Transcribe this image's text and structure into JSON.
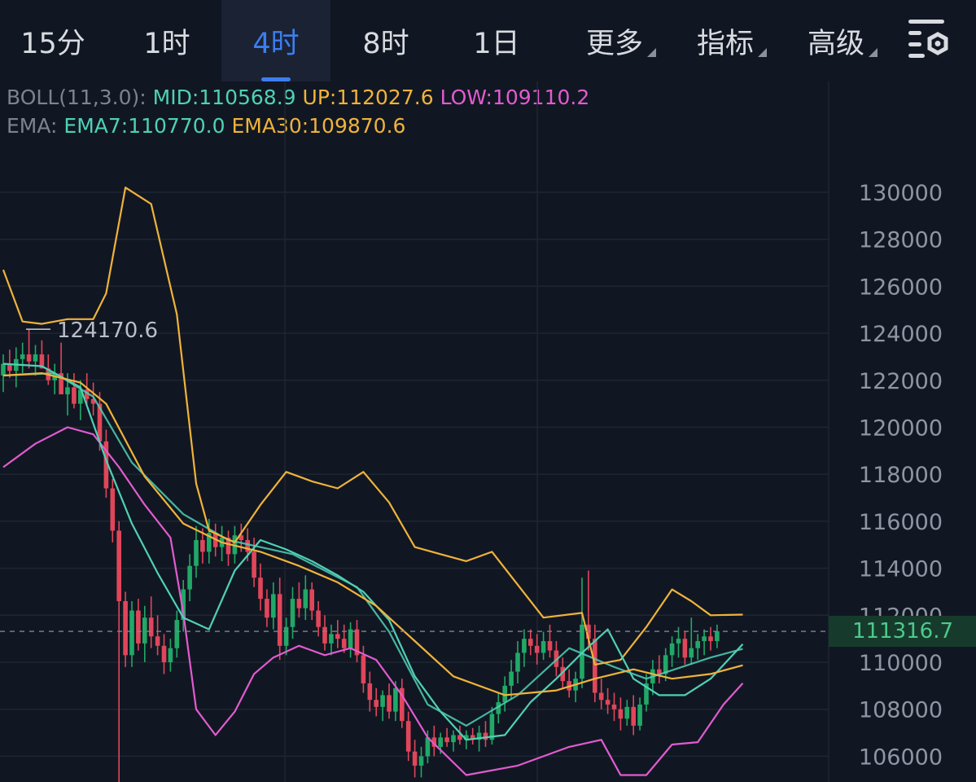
{
  "toolbar": {
    "tabs": [
      {
        "label": "15分",
        "active": false
      },
      {
        "label": "1时",
        "active": false
      },
      {
        "label": "4时",
        "active": true
      },
      {
        "label": "8时",
        "active": false
      },
      {
        "label": "1日",
        "active": false
      }
    ],
    "dropdowns": [
      {
        "label": "更多"
      },
      {
        "label": "指标"
      },
      {
        "label": "高级"
      }
    ],
    "settings_icon": "chart-settings-gear-icon"
  },
  "indicators": {
    "boll": {
      "label": "BOLL(11,3.0):",
      "mid": "MID:110568.9",
      "up": "UP:112027.6",
      "low": "LOW:109110.2"
    },
    "ema": {
      "label": "EMA:",
      "ema7": "EMA7:110770.0",
      "ema30": "EMA30:109870.6"
    }
  },
  "colors": {
    "background": "#111722",
    "up_candle": "#21a867",
    "down_candle": "#e0465a",
    "boll_mid": "#4fd1b6",
    "boll_up": "#f0b33a",
    "boll_low": "#e15bd0",
    "ema7": "#4fd1b6",
    "ema30": "#f0b33a",
    "active_tab": "#3c7ef0"
  },
  "chart_data": {
    "type": "candlestick",
    "ylim": [
      105000,
      132000
    ],
    "y_ticks": [
      "130000",
      "128000",
      "126000",
      "124000",
      "122000",
      "120000",
      "118000",
      "116000",
      "114000",
      "112000",
      "110000",
      "108000",
      "106000"
    ],
    "high_marker": "124170.6",
    "current_price": "111316.7",
    "candles": [
      [
        122200,
        123100,
        121500,
        122700
      ],
      [
        122700,
        123300,
        122100,
        122400
      ],
      [
        122400,
        123400,
        121700,
        122900
      ],
      [
        122900,
        123600,
        122300,
        123100
      ],
      [
        123100,
        124170.6,
        122500,
        122800
      ],
      [
        122800,
        123500,
        122200,
        123100
      ],
      [
        123100,
        123700,
        122600,
        122500
      ],
      [
        122500,
        123100,
        121800,
        122000
      ],
      [
        122000,
        122700,
        121400,
        122300
      ],
      [
        122300,
        123600,
        121900,
        121400
      ],
      [
        121400,
        122300,
        120500,
        121700
      ],
      [
        121700,
        122300,
        120800,
        121000
      ],
      [
        121000,
        122000,
        120300,
        121600
      ],
      [
        121600,
        122300,
        120900,
        121200
      ],
      [
        121200,
        121900,
        120500,
        121000
      ],
      [
        121000,
        121500,
        119000,
        119400
      ],
      [
        119400,
        119900,
        117000,
        117400
      ],
      [
        117400,
        117800,
        115100,
        115600
      ],
      [
        115600,
        116000,
        104000,
        112600
      ],
      [
        112600,
        113000,
        109800,
        110300
      ],
      [
        110300,
        112600,
        109800,
        112200
      ],
      [
        112200,
        112700,
        110500,
        110800
      ],
      [
        110800,
        112400,
        110000,
        111900
      ],
      [
        111900,
        112800,
        110600,
        111100
      ],
      [
        111100,
        112000,
        110300,
        110700
      ],
      [
        110700,
        111200,
        109500,
        110000
      ],
      [
        110000,
        111000,
        109600,
        110600
      ],
      [
        110600,
        112200,
        110200,
        111800
      ],
      [
        111800,
        113500,
        111300,
        113100
      ],
      [
        113100,
        114600,
        112600,
        114100
      ],
      [
        114100,
        115800,
        113600,
        115200
      ],
      [
        115200,
        115700,
        114200,
        114700
      ],
      [
        114700,
        116100,
        114200,
        115500
      ],
      [
        115500,
        115900,
        114500,
        114900
      ],
      [
        114900,
        115800,
        114300,
        115300
      ],
      [
        115300,
        115600,
        114100,
        114600
      ],
      [
        114600,
        115800,
        114200,
        115400
      ],
      [
        115400,
        115900,
        114700,
        115200
      ],
      [
        115200,
        115700,
        114300,
        114700
      ],
      [
        114700,
        115300,
        113200,
        113600
      ],
      [
        113600,
        114200,
        112200,
        112700
      ],
      [
        112700,
        113100,
        111500,
        111900
      ],
      [
        111900,
        113400,
        111400,
        112900
      ],
      [
        112900,
        113600,
        110100,
        110700
      ],
      [
        110700,
        111900,
        110300,
        111500
      ],
      [
        111500,
        113200,
        111000,
        112700
      ],
      [
        112700,
        113400,
        111900,
        112300
      ],
      [
        112300,
        113700,
        111800,
        113100
      ],
      [
        113100,
        113400,
        111800,
        112200
      ],
      [
        112200,
        112600,
        111100,
        111500
      ],
      [
        111500,
        112000,
        110500,
        110800
      ],
      [
        110800,
        111600,
        110300,
        111200
      ],
      [
        111200,
        111800,
        110600,
        111000
      ],
      [
        111000,
        111600,
        110400,
        110600
      ],
      [
        110600,
        111700,
        110200,
        111400
      ],
      [
        111400,
        111800,
        110000,
        110300
      ],
      [
        110300,
        110700,
        108700,
        109100
      ],
      [
        109100,
        109600,
        107900,
        108400
      ],
      [
        108400,
        108900,
        107700,
        108100
      ],
      [
        108100,
        108800,
        107500,
        108600
      ],
      [
        108600,
        109100,
        107600,
        107900
      ],
      [
        107900,
        109200,
        107500,
        108900
      ],
      [
        108900,
        109300,
        107200,
        107500
      ],
      [
        107500,
        107900,
        105800,
        106200
      ],
      [
        106200,
        106700,
        105100,
        105600
      ],
      [
        105600,
        106400,
        105100,
        106000
      ],
      [
        106000,
        107100,
        105700,
        106800
      ],
      [
        106800,
        107300,
        106000,
        106400
      ],
      [
        106400,
        107000,
        106100,
        106800
      ],
      [
        106800,
        107200,
        106400,
        106600
      ],
      [
        106600,
        107100,
        106200,
        106900
      ],
      [
        106900,
        107300,
        106500,
        106700
      ],
      [
        106700,
        107100,
        106300,
        106900
      ],
      [
        106900,
        107200,
        106500,
        106700
      ],
      [
        106700,
        107300,
        106200,
        107000
      ],
      [
        107000,
        107500,
        106400,
        106700
      ],
      [
        106700,
        108100,
        106500,
        107800
      ],
      [
        107800,
        108700,
        107400,
        108300
      ],
      [
        108300,
        109400,
        107900,
        109000
      ],
      [
        109000,
        110100,
        108400,
        109600
      ],
      [
        109600,
        110900,
        109100,
        110400
      ],
      [
        110400,
        111400,
        109800,
        111000
      ],
      [
        111000,
        111400,
        110300,
        110700
      ],
      [
        110700,
        111200,
        109900,
        110400
      ],
      [
        110400,
        111300,
        110100,
        110900
      ],
      [
        110900,
        111600,
        110200,
        110500
      ],
      [
        110500,
        110900,
        109400,
        109800
      ],
      [
        109800,
        110200,
        108900,
        109200
      ],
      [
        109200,
        109700,
        108500,
        108800
      ],
      [
        108800,
        109600,
        108300,
        109300
      ],
      [
        109300,
        113600,
        108900,
        111600
      ],
      [
        111600,
        113900,
        110500,
        111000
      ],
      [
        111000,
        111600,
        108300,
        108700
      ],
      [
        108700,
        109300,
        108000,
        108400
      ],
      [
        108400,
        108900,
        107800,
        108200
      ],
      [
        108200,
        108700,
        107500,
        108000
      ],
      [
        108000,
        108500,
        107100,
        107600
      ],
      [
        107600,
        108400,
        107300,
        108100
      ],
      [
        108100,
        108600,
        106900,
        107300
      ],
      [
        107300,
        108500,
        107100,
        108200
      ],
      [
        108200,
        109500,
        107900,
        109100
      ],
      [
        109100,
        110100,
        108600,
        109700
      ],
      [
        109700,
        110300,
        109100,
        109500
      ],
      [
        109500,
        110600,
        109200,
        110300
      ],
      [
        110300,
        111100,
        109800,
        110800
      ],
      [
        110800,
        111500,
        110200,
        111000
      ],
      [
        111000,
        111300,
        109900,
        110200
      ],
      [
        110200,
        111900,
        109900,
        110600
      ],
      [
        110600,
        111200,
        110100,
        110900
      ],
      [
        110900,
        111400,
        110300,
        111100
      ],
      [
        111100,
        111500,
        110500,
        110900
      ],
      [
        110900,
        111600,
        110600,
        111316.7
      ]
    ],
    "series": [
      {
        "name": "MID",
        "points": [
          [
            0,
            122200
          ],
          [
            8,
            122300
          ],
          [
            14,
            121300
          ],
          [
            20,
            118500
          ],
          [
            28,
            116300
          ],
          [
            35,
            115200
          ],
          [
            45,
            114600
          ],
          [
            55,
            113200
          ],
          [
            60,
            111300
          ],
          [
            66,
            108200
          ],
          [
            72,
            107300
          ],
          [
            80,
            108600
          ],
          [
            88,
            110600
          ],
          [
            95,
            109800
          ],
          [
            100,
            109300
          ],
          [
            110,
            110200
          ],
          [
            115,
            110568.9
          ]
        ]
      },
      {
        "name": "UP",
        "points": [
          [
            0,
            126700
          ],
          [
            3,
            124500
          ],
          [
            6,
            124400
          ],
          [
            10,
            124600
          ],
          [
            14,
            124600
          ],
          [
            16,
            125700
          ],
          [
            19,
            130200
          ],
          [
            23,
            129500
          ],
          [
            27,
            124800
          ],
          [
            30,
            117600
          ],
          [
            32,
            115600
          ],
          [
            36,
            115100
          ],
          [
            40,
            116700
          ],
          [
            44,
            118100
          ],
          [
            48,
            117700
          ],
          [
            52,
            117400
          ],
          [
            56,
            118100
          ],
          [
            60,
            116800
          ],
          [
            64,
            114900
          ],
          [
            68,
            114600
          ],
          [
            72,
            114300
          ],
          [
            76,
            114700
          ],
          [
            80,
            113300
          ],
          [
            84,
            111900
          ],
          [
            90,
            112100
          ],
          [
            92,
            109900
          ],
          [
            96,
            110100
          ],
          [
            100,
            111500
          ],
          [
            104,
            113100
          ],
          [
            107,
            112600
          ],
          [
            110,
            112000
          ],
          [
            115,
            112027.6
          ]
        ]
      },
      {
        "name": "LOW",
        "points": [
          [
            0,
            118300
          ],
          [
            5,
            119300
          ],
          [
            10,
            120000
          ],
          [
            14,
            119700
          ],
          [
            18,
            118300
          ],
          [
            22,
            116700
          ],
          [
            26,
            115300
          ],
          [
            28,
            112100
          ],
          [
            30,
            108000
          ],
          [
            33,
            106900
          ],
          [
            36,
            107900
          ],
          [
            39,
            109500
          ],
          [
            42,
            110200
          ],
          [
            46,
            110700
          ],
          [
            50,
            110300
          ],
          [
            54,
            110600
          ],
          [
            58,
            110100
          ],
          [
            62,
            108600
          ],
          [
            66,
            106800
          ],
          [
            72,
            105200
          ],
          [
            80,
            105600
          ],
          [
            88,
            106400
          ],
          [
            93,
            106700
          ],
          [
            96,
            105200
          ],
          [
            100,
            105200
          ],
          [
            104,
            106500
          ],
          [
            108,
            106600
          ],
          [
            112,
            108200
          ],
          [
            115,
            109110.2
          ]
        ]
      },
      {
        "name": "EMA7",
        "points": [
          [
            0,
            122700
          ],
          [
            6,
            122600
          ],
          [
            12,
            121700
          ],
          [
            16,
            118600
          ],
          [
            20,
            115900
          ],
          [
            24,
            113800
          ],
          [
            28,
            111900
          ],
          [
            32,
            111400
          ],
          [
            36,
            113900
          ],
          [
            40,
            115200
          ],
          [
            44,
            114800
          ],
          [
            48,
            114300
          ],
          [
            52,
            113700
          ],
          [
            56,
            113000
          ],
          [
            60,
            111800
          ],
          [
            64,
            109400
          ],
          [
            68,
            107900
          ],
          [
            72,
            106700
          ],
          [
            78,
            106900
          ],
          [
            82,
            108300
          ],
          [
            86,
            109300
          ],
          [
            90,
            110400
          ],
          [
            94,
            111400
          ],
          [
            98,
            109300
          ],
          [
            102,
            108600
          ],
          [
            106,
            108600
          ],
          [
            110,
            109300
          ],
          [
            115,
            110770.0
          ]
        ]
      },
      {
        "name": "EMA30",
        "points": [
          [
            0,
            122200
          ],
          [
            6,
            122300
          ],
          [
            12,
            121900
          ],
          [
            16,
            121000
          ],
          [
            22,
            117900
          ],
          [
            28,
            115900
          ],
          [
            34,
            115100
          ],
          [
            40,
            114700
          ],
          [
            46,
            114100
          ],
          [
            52,
            113400
          ],
          [
            58,
            112400
          ],
          [
            64,
            110900
          ],
          [
            70,
            109400
          ],
          [
            78,
            108600
          ],
          [
            86,
            108800
          ],
          [
            92,
            109300
          ],
          [
            98,
            109700
          ],
          [
            104,
            109300
          ],
          [
            110,
            109500
          ],
          [
            115,
            109870.6
          ]
        ]
      }
    ]
  }
}
